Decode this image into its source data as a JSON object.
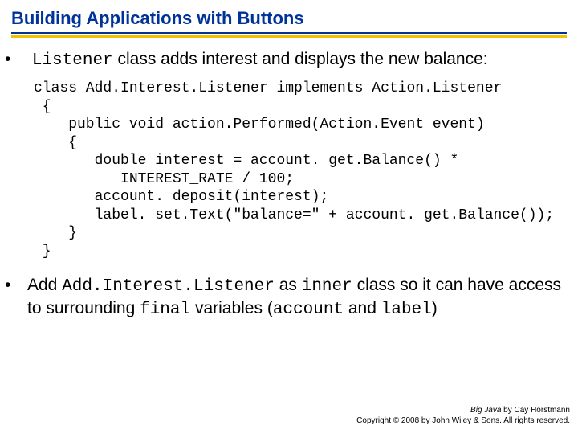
{
  "title": "Building Applications with Buttons",
  "bullet1": {
    "pre_mono": "Listener",
    "post": " class adds interest and displays the new balance:"
  },
  "code": "class Add.Interest.Listener implements Action.Listener\n {\n    public void action.Performed(Action.Event event)\n    {\n       double interest = account. get.Balance() *\n          INTEREST_RATE / 100;\n       account. deposit(interest);\n       label. set.Text(\"balance=\" + account. get.Balance());\n    }\n }",
  "bullet2": {
    "p1": "Add ",
    "m1": "Add.Interest.Listener",
    "p2": " as ",
    "m2": "inner",
    "p3": " class so it can have access to surrounding ",
    "m3": "final",
    "p4": " variables (",
    "m4": "account",
    "p5": " and ",
    "m5": "label",
    "p6": ")"
  },
  "footer": {
    "book": "Big Java",
    "author": " by Cay Horstmann",
    "copyright": "Copyright © 2008 by John Wiley & Sons. All rights reserved."
  }
}
